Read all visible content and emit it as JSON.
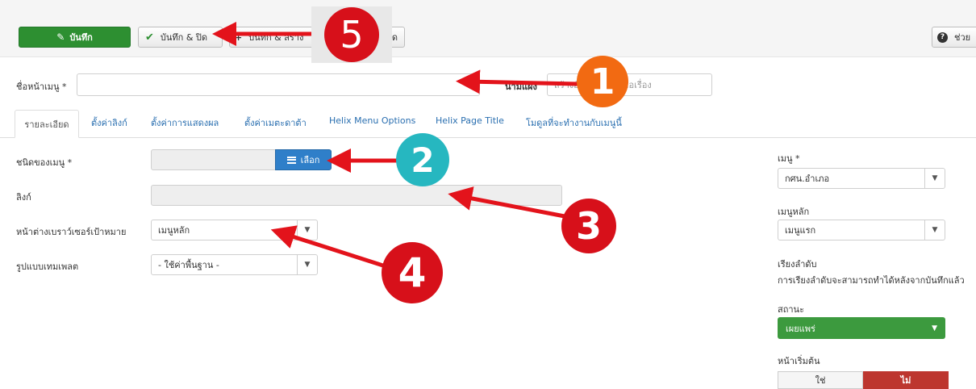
{
  "toolbar": {
    "save_label": "บันทึก",
    "save_close_label": "บันทึก & ปิด",
    "save_new_label": "บันทึก & สร้าง",
    "cancel_label": "ปิด",
    "help_label": "ช่วย"
  },
  "form": {
    "title_label": "ชื่อหน้าเมนู *",
    "title_value": "",
    "alias_label": "นามแฝง",
    "alias_placeholder": "สร้างอัตโนมัติจากชื่อเรื่อง"
  },
  "tabs": [
    {
      "label": "รายละเอียด",
      "active": true
    },
    {
      "label": "ตั้งค่าลิงก์"
    },
    {
      "label": "ตั้งค่าการแสดงผล"
    },
    {
      "label": "ตั้งค่าเมตะดาต้า"
    },
    {
      "label": "Helix Menu Options"
    },
    {
      "label": "Helix Page Title"
    },
    {
      "label": "โมดูลที่จะทำงานกับเมนูนี้"
    }
  ],
  "details": {
    "menu_type_label": "ชนิดของเมนู *",
    "menu_type_value": "",
    "select_button": "เลือก",
    "link_label": "ลิงก์",
    "link_value": "",
    "target_window_label": "หน้าต่างเบราว์เซอร์เป้าหมาย",
    "target_window_value": "เมนูหลัก",
    "template_style_label": "รูปแบบเทมเพลต",
    "template_style_value": "- ใช้ค่าพื้นฐาน -"
  },
  "sidebar": {
    "menu_label": "เมนู *",
    "menu_value": "กศน.อำเภอ",
    "parent_label": "เมนูหลัก",
    "parent_value": "เมนูแรก",
    "ordering_label": "เรียงลำดับ",
    "ordering_note": "การเรียงลำดับจะสามารถทำได้หลังจากบันทึกแล้ว",
    "status_label": "สถานะ",
    "status_value": "เผยแพร่",
    "home_label": "หน้าเริ่มต้น",
    "home_yes": "ใช่",
    "home_no": "ไม่"
  },
  "annotations": {
    "c1": "1",
    "c2": "2",
    "c3": "3",
    "c4": "4",
    "c5": "5"
  },
  "colors": {
    "save_green": "#2d8f31",
    "select_blue": "#2f7fc9",
    "status_green": "#3c9a3e",
    "no_red": "#bd362f",
    "arrow_red": "#e3131b",
    "callout_orange": "#f26a12",
    "callout_teal": "#26b7c0"
  }
}
